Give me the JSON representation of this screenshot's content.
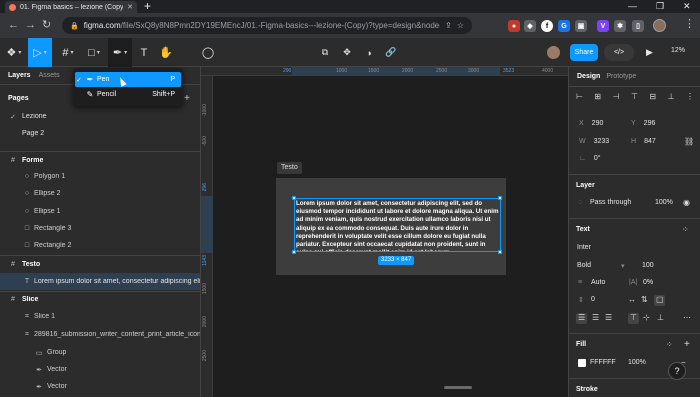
{
  "browser": {
    "tab_title": "01. Figma basics – lezione (Copy)",
    "url_host": "figma.com",
    "url_path": "/file/SxQ8y8N8Pmn2DY19EMEncJ/01.-Figma-basics---lezione-(Copy)?type=design&node-id=2-107&...",
    "new_tab": "+",
    "tab_close": "✕",
    "win_min": "—",
    "win_max": "❐",
    "win_close": "✕",
    "back": "←",
    "forward": "→",
    "reload": "↻",
    "menu": "⋮"
  },
  "toolbar": {
    "figma_menu_icon": "figma-logo-icon",
    "move_tool": "▷",
    "frame_tool": "#",
    "shape_tool": "□",
    "pen_tool": "✒",
    "text_tool": "T",
    "hand_tool": "✋",
    "comment_tool": "◯",
    "caret": "▾",
    "share_label": "Share",
    "code_label": "</>",
    "play": "▶",
    "zoom": "12%"
  },
  "pen_menu": {
    "items": [
      {
        "label": "Pen",
        "shortcut": "P",
        "check": "✓",
        "icon": "✒"
      },
      {
        "label": "Pencil",
        "shortcut": "Shift+P",
        "check": "",
        "icon": "✎"
      }
    ]
  },
  "left_panel": {
    "tabs": [
      "Layers",
      "Assets"
    ],
    "pages_header": "Pages",
    "pages": [
      {
        "check": "✓",
        "label": "Lezione"
      },
      {
        "check": "",
        "label": "Page 2"
      }
    ],
    "layers": [
      {
        "icon": "#",
        "label": "Forme",
        "style": "bold"
      },
      {
        "icon": "○",
        "label": "Polygon 1",
        "style": "muted"
      },
      {
        "icon": "○",
        "label": "Ellipse 2",
        "style": "muted"
      },
      {
        "icon": "○",
        "label": "Ellipse 1",
        "style": "muted"
      },
      {
        "icon": "□",
        "label": "Rectangle 3",
        "style": "muted"
      },
      {
        "icon": "□",
        "label": "Rectangle 2",
        "style": "muted"
      },
      {
        "icon": "#",
        "label": "Testo",
        "style": "bold"
      },
      {
        "icon": "T",
        "label": "Lorem ipsum dolor sit amet, consectetur adipiscing elit...",
        "style": "selected"
      },
      {
        "icon": "#",
        "label": "Slice",
        "style": "bold"
      },
      {
        "icon": "⌗",
        "label": "Slice 1",
        "style": "muted"
      },
      {
        "icon": "⌗",
        "label": "289816_submission_writer_content_print_article_icon 1",
        "style": "muted"
      },
      {
        "icon": "▭",
        "label": "Group",
        "style": "muted"
      },
      {
        "icon": "✒",
        "label": "Vector",
        "style": "muted"
      },
      {
        "icon": "✒",
        "label": "Vector",
        "style": "muted"
      }
    ]
  },
  "rulers": {
    "top": [
      {
        "label": "290",
        "hl": true
      },
      {
        "label": "1000",
        "hl": false
      },
      {
        "label": "1500",
        "hl": false
      },
      {
        "label": "2000",
        "hl": false
      },
      {
        "label": "2500",
        "hl": false
      },
      {
        "label": "3000",
        "hl": false
      },
      {
        "label": "3523",
        "hl": true
      },
      {
        "label": "4000",
        "hl": false
      }
    ],
    "left": [
      {
        "label": "-1000",
        "hl": false
      },
      {
        "label": "-500",
        "hl": false
      },
      {
        "label": "296",
        "hl": true
      },
      {
        "label": "1143",
        "hl": true
      },
      {
        "label": "1500",
        "hl": false
      },
      {
        "label": "2000",
        "hl": false
      },
      {
        "label": "2500",
        "hl": false
      }
    ]
  },
  "canvas": {
    "frame_label": "Testo",
    "text_content": "Lorem ipsum dolor sit amet, consectetur adipiscing elit, sed do eiusmod tempor incididunt ut labore et dolore magna aliqua. Ut enim ad minim veniam, quis nostrud exercitation ullamco laboris nisi ut aliquip ex ea commodo consequat. Duis aute irure dolor in reprehenderit in voluptate velit esse cillum dolore eu fugiat nulla pariatur. Excepteur sint occaecat cupidatat non proident, sunt in culpa qui officia deserunt mollit anim id est laborum.",
    "dimensions": "3233 × 847"
  },
  "right_panel": {
    "tabs": [
      "Design",
      "Prototype"
    ],
    "x_label": "X",
    "x_value": "290",
    "y_label": "Y",
    "y_value": "296",
    "w_label": "W",
    "w_value": "3233",
    "h_label": "H",
    "h_value": "847",
    "rotation": "0°",
    "layer_header": "Layer",
    "blend_mode": "Pass through",
    "layer_opacity": "100%",
    "text_header": "Text",
    "font_family": "Inter",
    "font_weight": "Bold",
    "font_size": "100",
    "line_height": "Auto",
    "letter_spacing": "0%",
    "paragraph_spacing": "0",
    "fill_header": "Fill",
    "fill_hex": "FFFFFF",
    "fill_opacity": "100%",
    "stroke_header": "Stroke",
    "help": "?"
  }
}
